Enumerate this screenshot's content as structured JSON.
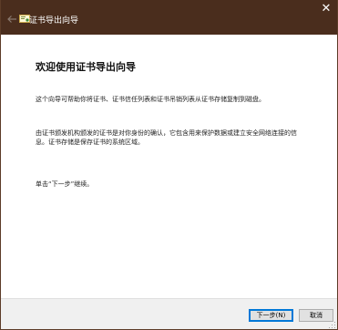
{
  "window": {
    "title": "证书导出向导",
    "close_glyph": "✕"
  },
  "content": {
    "heading": "欢迎使用证书导出向导",
    "paragraph1": "这个向导可帮助你将证书、证书信任列表和证书吊销列表从证书存储复制到磁盘。",
    "paragraph2": "由证书颁发机构颁发的证书是对你身份的确认，它包含用来保护数据或建立安全网络连接的信息。证书存储是保存证书的系统区域。",
    "paragraph3": "单击“下一步”继续。"
  },
  "footer": {
    "next_label": "下一步(N)",
    "cancel_label": "取消"
  },
  "colors": {
    "titlebar": "#4a2d1d",
    "accent": "#0078d7",
    "footer_bg": "#f0f0f0"
  },
  "icons": {
    "back": "back-arrow-icon",
    "wizard": "certificate-icon",
    "close": "close-icon",
    "grip": "resize-grip-icon"
  }
}
